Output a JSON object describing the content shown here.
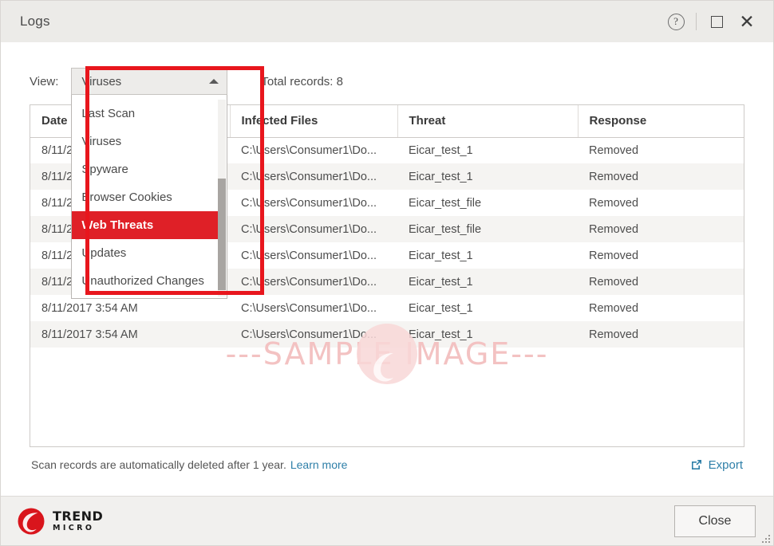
{
  "titlebar": {
    "title": "Logs",
    "help_icon": "help-circle-icon",
    "maximize_icon": "maximize-square-icon",
    "close_icon": "close-x-icon"
  },
  "controls": {
    "view_label": "View:",
    "combo_value": "Viruses",
    "caret_icon": "chevron-up-icon",
    "total_records": "Total records: 8"
  },
  "dropdown": {
    "items": [
      {
        "label": "Last Scan",
        "selected": false
      },
      {
        "label": "Viruses",
        "selected": false
      },
      {
        "label": "Spyware",
        "selected": false
      },
      {
        "label": "Browser Cookies",
        "selected": false
      },
      {
        "label": "Web Threats",
        "selected": true
      },
      {
        "label": "Updates",
        "selected": false
      },
      {
        "label": "Unauthorized Changes",
        "selected": false
      }
    ]
  },
  "table": {
    "columns": [
      "Date",
      "Infected Files",
      "Threat",
      "Response"
    ],
    "rows": [
      [
        "8/11/2017 3:54 AM",
        "C:\\Users\\Consumer1\\Do...",
        "Eicar_test_1",
        "Removed"
      ],
      [
        "8/11/2017 3:54 AM",
        "C:\\Users\\Consumer1\\Do...",
        "Eicar_test_1",
        "Removed"
      ],
      [
        "8/11/2017 3:54 AM",
        "C:\\Users\\Consumer1\\Do...",
        "Eicar_test_file",
        "Removed"
      ],
      [
        "8/11/2017 3:54 AM",
        "C:\\Users\\Consumer1\\Do...",
        "Eicar_test_file",
        "Removed"
      ],
      [
        "8/11/2017 3:54 AM",
        "C:\\Users\\Consumer1\\Do...",
        "Eicar_test_1",
        "Removed"
      ],
      [
        "8/11/2017 3:54 AM",
        "C:\\Users\\Consumer1\\Do...",
        "Eicar_test_1",
        "Removed"
      ],
      [
        "8/11/2017 3:54 AM",
        "C:\\Users\\Consumer1\\Do...",
        "Eicar_test_1",
        "Removed"
      ],
      [
        "8/11/2017 3:54 AM",
        "C:\\Users\\Consumer1\\Do...",
        "Eicar_test_1",
        "Removed"
      ]
    ]
  },
  "watermark": {
    "text": "---SAMPLE IMAGE---"
  },
  "footer": {
    "note": "Scan records are automatically deleted after 1 year.",
    "learn_more": "Learn more",
    "export_label": "Export",
    "export_icon": "external-link-icon"
  },
  "bottom": {
    "logo_primary": "TREND",
    "logo_secondary": "MICRO",
    "logo_icon": "trend-micro-logo-icon",
    "close_label": "Close",
    "resize_grip_icon": "resize-grip-icon"
  },
  "colors": {
    "brand_red": "#df2027",
    "annotation_red": "#e8161d",
    "link_blue": "#2e7fa8",
    "titlebar_bg": "#ecebe8"
  }
}
